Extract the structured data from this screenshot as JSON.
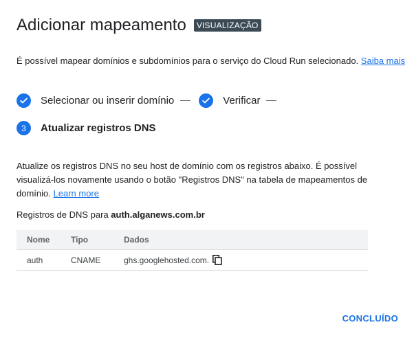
{
  "header": {
    "title": "Adicionar mapeamento",
    "badge": "VISUALIZAÇÃO"
  },
  "intro": {
    "text": "É possível mapear domínios e subdomínios para o serviço do Cloud Run selecionado.",
    "link": "Saiba mais"
  },
  "steps": [
    {
      "label": "Selecionar ou inserir domínio",
      "status": "done"
    },
    {
      "label": "Verificar",
      "status": "done"
    },
    {
      "number": "3",
      "label": "Atualizar registros DNS",
      "status": "active"
    }
  ],
  "description": {
    "text": "Atualize os registros DNS no seu host de domínio com os registros abaixo. É possível visualizá-los novamente usando o botão \"Registros DNS\" na tabela de mapeamentos de domínio.",
    "link": "Learn more"
  },
  "dns": {
    "caption_prefix": "Registros de DNS para",
    "domain": "auth.alganews.com.br",
    "columns": [
      "Nome",
      "Tipo",
      "Dados"
    ],
    "rows": [
      {
        "name": "auth",
        "type": "CNAME",
        "data": "ghs.googlehosted.com."
      }
    ]
  },
  "actions": {
    "done_label": "CONCLUÍDO"
  },
  "colors": {
    "accent": "#1a73e8",
    "badge_bg": "#3c4a55",
    "header_bg": "#f1f3f4"
  },
  "icons": {
    "step_done": "check-circle-icon",
    "copy": "copy-icon"
  }
}
